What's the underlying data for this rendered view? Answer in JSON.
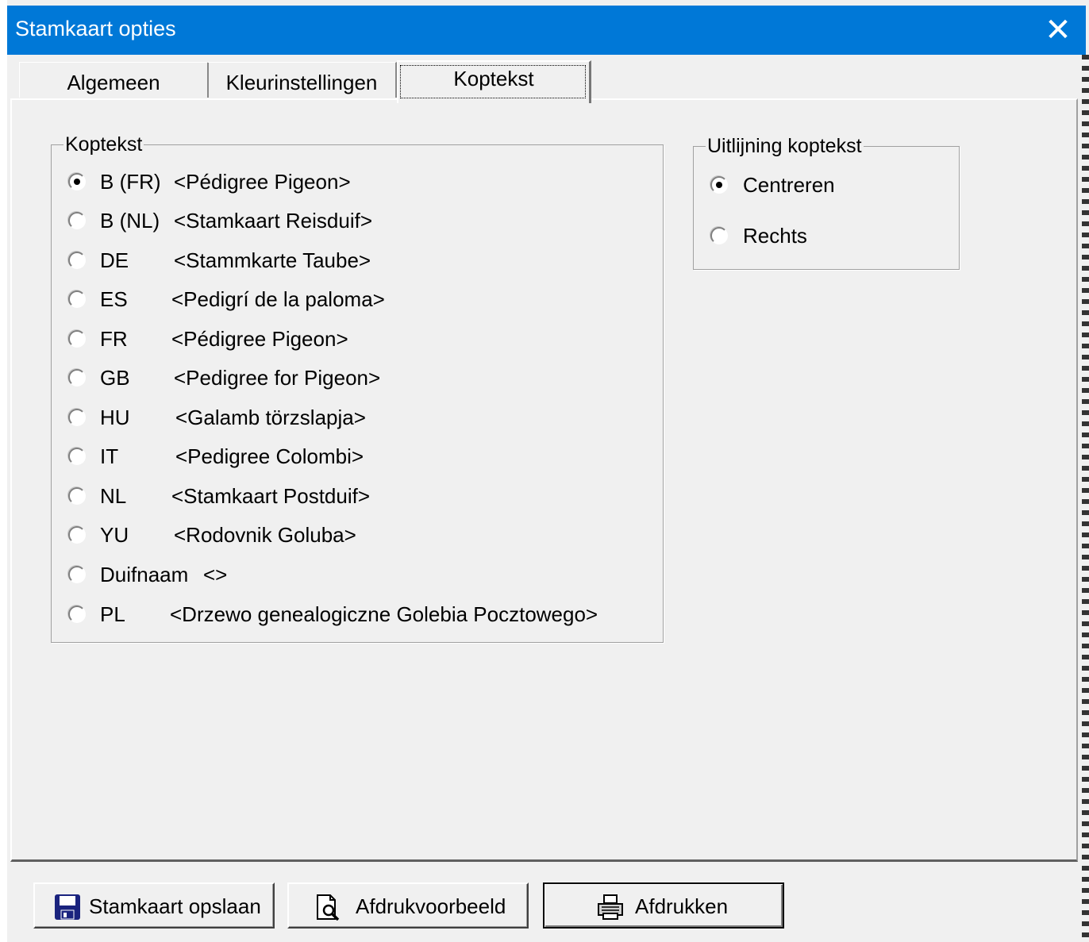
{
  "window": {
    "title": "Stamkaart opties",
    "close_glyph": "✕"
  },
  "tabs": [
    {
      "label": "Algemeen"
    },
    {
      "label": "Kleurinstellingen"
    },
    {
      "label": "Koptekst",
      "active": true
    }
  ],
  "koptekst_group": {
    "legend": "Koptekst",
    "options": [
      {
        "code": "B (FR)",
        "text": "<Pédigree Pigeon>",
        "checked": true
      },
      {
        "code": "B (NL)",
        "text": "<Stamkaart Reisduif>",
        "checked": false
      },
      {
        "code": "DE",
        "text": "<Stammkarte Taube>",
        "checked": false
      },
      {
        "code": "ES",
        "text": "<Pedigrí de la paloma>",
        "checked": false
      },
      {
        "code": "FR",
        "text": "<Pédigree Pigeon>",
        "checked": false
      },
      {
        "code": "GB",
        "text": "<Pedigree for Pigeon>",
        "checked": false
      },
      {
        "code": "HU",
        "text": "<Galamb törzslapja>",
        "checked": false
      },
      {
        "code": "IT",
        "text": "<Pedigree Colombi>",
        "checked": false
      },
      {
        "code": "NL",
        "text": "<Stamkaart Postduif>",
        "checked": false
      },
      {
        "code": "YU",
        "text": "<Rodovnik Goluba>",
        "checked": false
      },
      {
        "code": "Duifnaam",
        "text": "<>",
        "checked": false
      },
      {
        "code": "PL",
        "text": "<Drzewo genealogiczne Golebia Pocztowego>",
        "checked": false
      }
    ]
  },
  "alignment_group": {
    "legend": "Uitlijning koptekst",
    "options": [
      {
        "label": "Centreren",
        "checked": true
      },
      {
        "label": "Rechts",
        "checked": false
      }
    ]
  },
  "buttons": {
    "save": {
      "label": "Stamkaart opslaan",
      "icon": "floppy-disk-icon"
    },
    "preview": {
      "label": "Afdrukvoorbeeld",
      "icon": "print-preview-icon"
    },
    "print": {
      "label": "Afdrukken",
      "icon": "printer-icon"
    }
  },
  "colors": {
    "titlebar": "#0078d7",
    "face": "#f0f0f0"
  }
}
